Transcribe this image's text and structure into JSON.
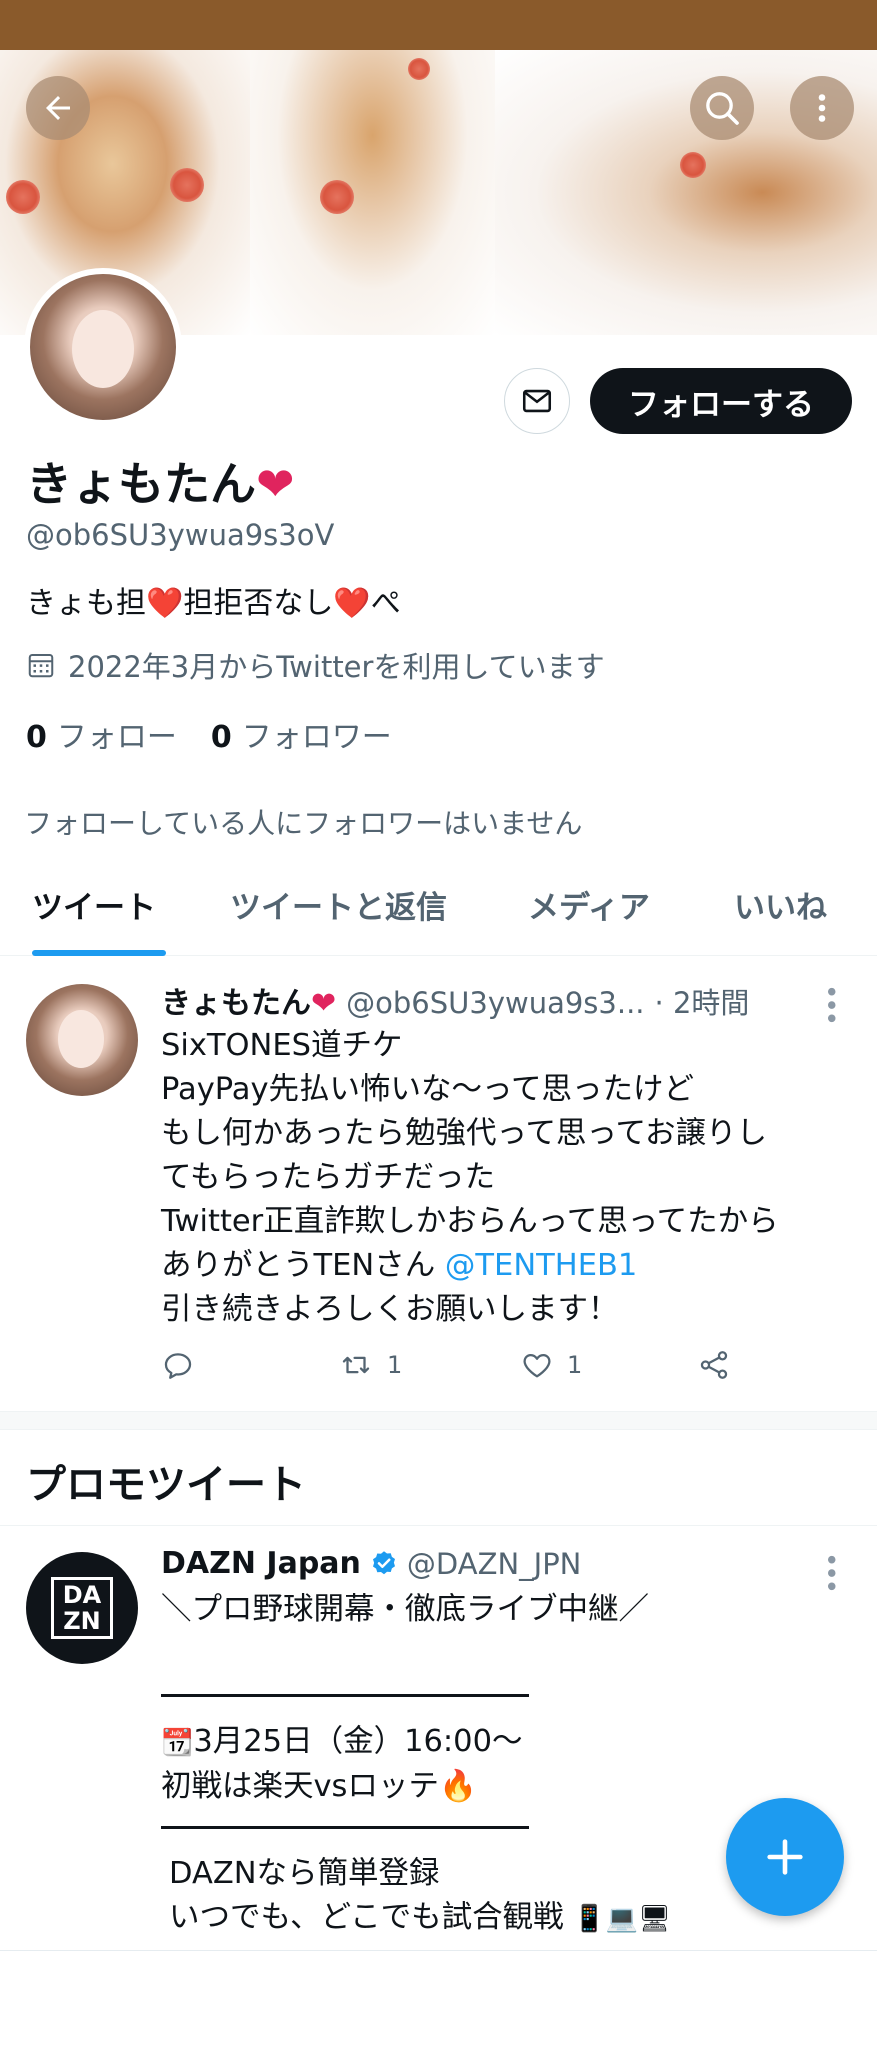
{
  "profile": {
    "name": "きょもたん",
    "handle": "@ob6SU3ywua9s3oV",
    "bio": "きょも担❤️担拒否なし❤️ぺ",
    "joined": "2022年3月からTwitterを利用しています",
    "following_count": "0",
    "following_label": "フォロー",
    "followers_count": "0",
    "followers_label": "フォロワー",
    "no_followers_you_know": "フォローしている人にフォロワーはいません",
    "follow_button": "フォローする"
  },
  "tabs": [
    {
      "label": "ツイート",
      "active": true
    },
    {
      "label": "ツイートと返信",
      "active": false
    },
    {
      "label": "メディア",
      "active": false
    },
    {
      "label": "いいね",
      "active": false
    }
  ],
  "tweet": {
    "name": "きょもたん",
    "handle": "@ob6SU3ywua9s3...",
    "time": "· 2時間",
    "lines": [
      "SixTONES道チケ",
      "PayPay先払い怖いな〜って思ったけど",
      "もし何かあったら勉強代って思ってお譲りし",
      "てもらったらガチだった",
      "Twitter正直詐欺しかおらんって思ってたから",
      "ありがとうTENさん",
      "引き続きよろしくお願いします！"
    ],
    "mention": "@TENTHEB1",
    "retweets": "1",
    "likes": "1"
  },
  "promo": {
    "section_title": "プロモツイート",
    "name": "DAZN Japan",
    "handle": "@DAZN_JPN",
    "logo_line1": "DA",
    "logo_line2": "ZN",
    "line1": "＼プロ野球開幕・徹底ライブ中継／",
    "line2": "3月25日（金）16:00〜",
    "line3": "初戦は楽天vsロッテ🔥",
    "line4": "DAZNなら簡単登録",
    "line5": "いつでも、どこでも試合観戦"
  },
  "colors": {
    "accent": "#1d9bf0",
    "heart": "#e0245e",
    "status_bar": "#8a5a2b"
  },
  "icons": [
    "back-arrow-icon",
    "search-icon",
    "more-vertical-icon",
    "mail-icon",
    "calendar-icon",
    "reply-icon",
    "retweet-icon",
    "like-icon",
    "share-icon",
    "verified-icon",
    "plus-icon"
  ]
}
